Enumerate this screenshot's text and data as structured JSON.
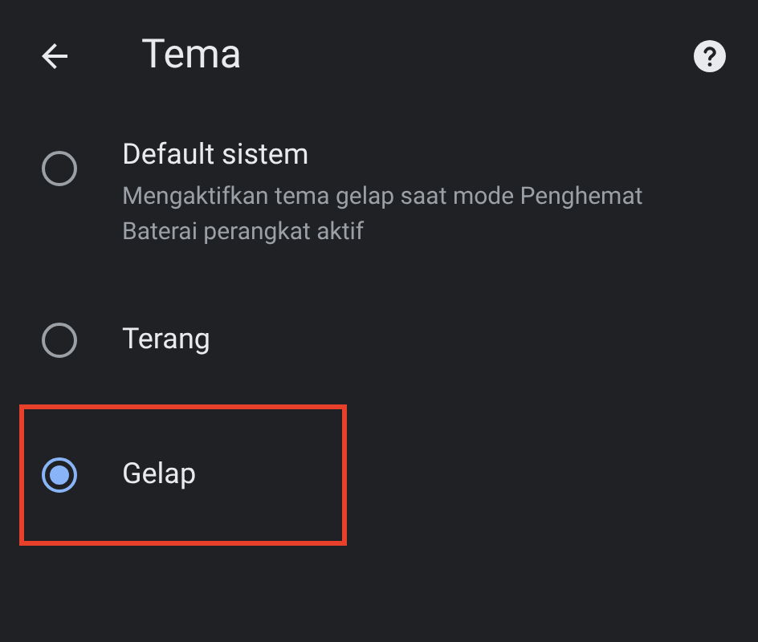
{
  "header": {
    "title": "Tema"
  },
  "options": [
    {
      "label": "Default sistem",
      "description": "Mengaktifkan tema gelap saat mode Penghemat Baterai perangkat aktif",
      "selected": false,
      "highlighted": false
    },
    {
      "label": "Terang",
      "selected": false,
      "highlighted": false
    },
    {
      "label": "Gelap",
      "selected": true,
      "highlighted": true
    }
  ]
}
